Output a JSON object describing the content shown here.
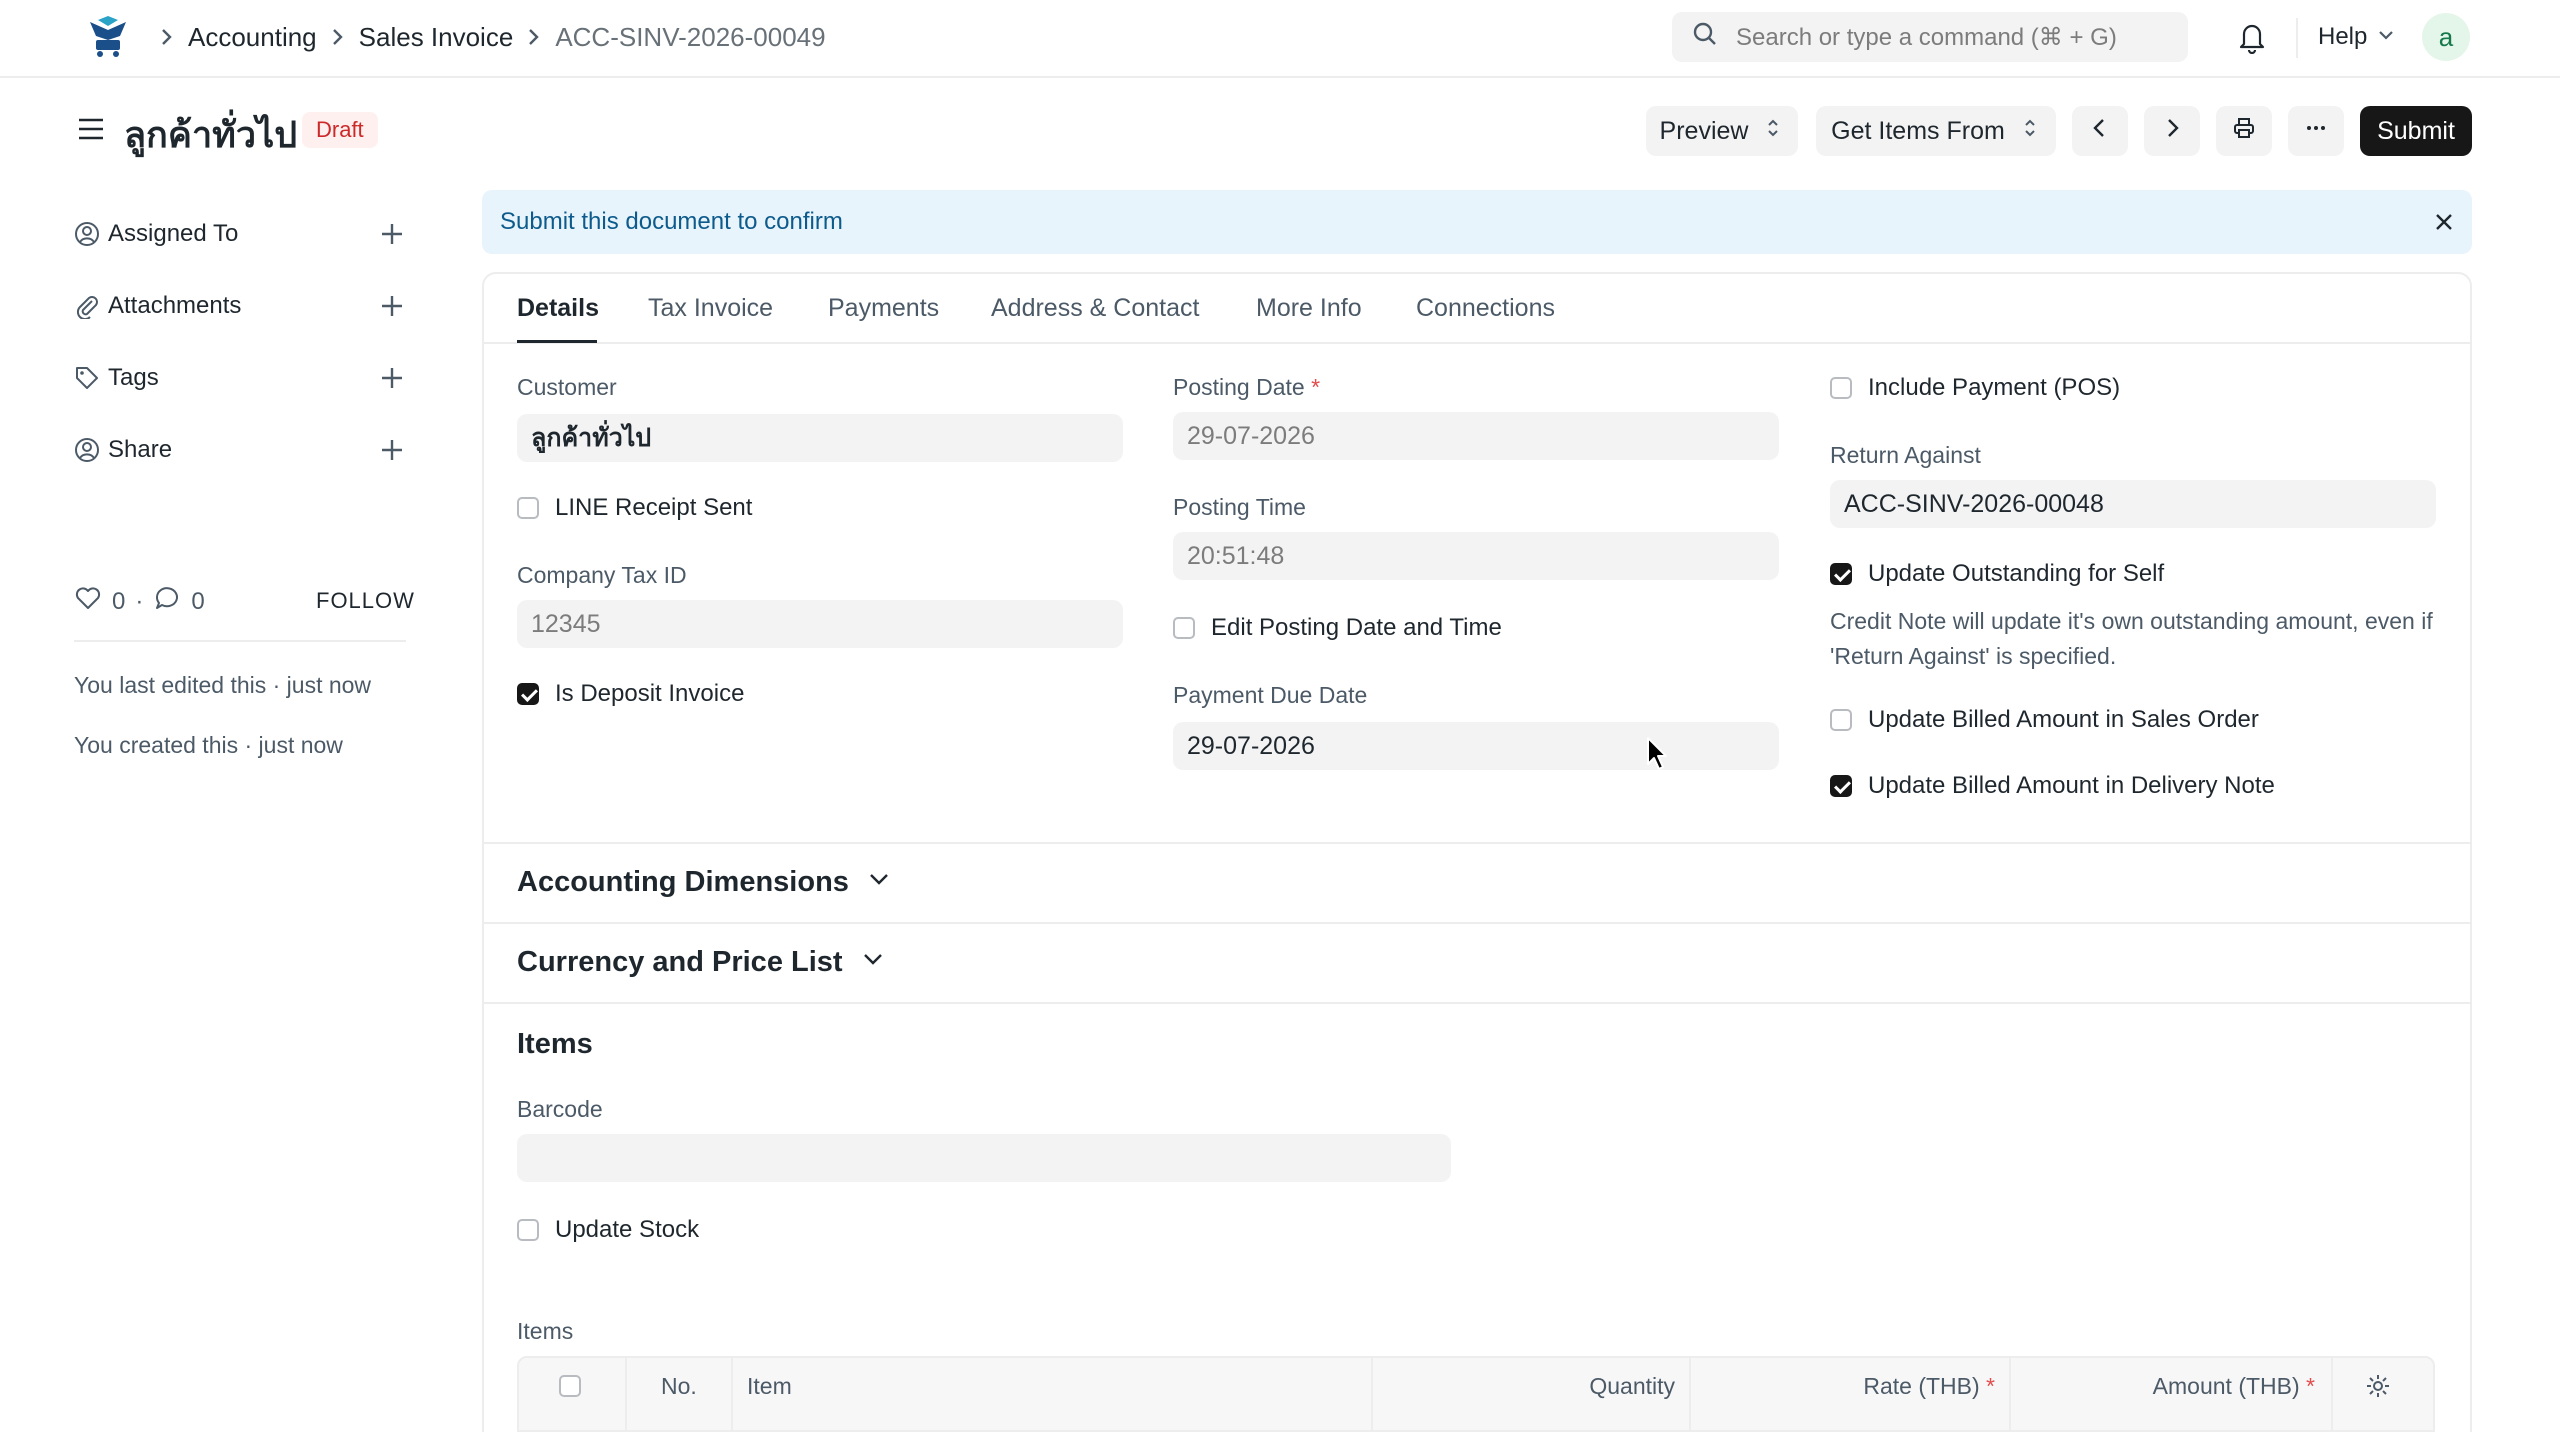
{
  "navbar": {
    "breadcrumbs": [
      "Accounting",
      "Sales Invoice",
      "ACC-SINV-2026-00049"
    ],
    "search_placeholder": "Search or type a command (⌘ + G)",
    "help_label": "Help",
    "avatar_letter": "a"
  },
  "page": {
    "title": "ลูกค้าทั่วไป",
    "status": "Draft",
    "preview_label": "Preview",
    "get_items_label": "Get Items From",
    "submit_label": "Submit"
  },
  "sidebar": {
    "items": [
      {
        "label": "Assigned To",
        "icon": "user-circle-icon"
      },
      {
        "label": "Attachments",
        "icon": "paperclip-icon"
      },
      {
        "label": "Tags",
        "icon": "tag-icon"
      },
      {
        "label": "Share",
        "icon": "share-user-icon"
      }
    ],
    "likes_count": "0",
    "comments_count": "0",
    "follow_label": "FOLLOW",
    "last_edited": "You last edited this · just now",
    "created": "You created this · just now"
  },
  "alert": {
    "message": "Submit this document to confirm"
  },
  "tabs": [
    "Details",
    "Tax Invoice",
    "Payments",
    "Address & Contact",
    "More Info",
    "Connections"
  ],
  "form": {
    "customer_label": "Customer",
    "customer_value": "ลูกค้าทั่วไป",
    "line_receipt_label": "LINE Receipt Sent",
    "line_receipt_checked": false,
    "company_tax_label": "Company Tax ID",
    "company_tax_value": "12345",
    "is_deposit_label": "Is Deposit Invoice",
    "is_deposit_checked": true,
    "posting_date_label": "Posting Date",
    "posting_date_value": "29-07-2026",
    "posting_time_label": "Posting Time",
    "posting_time_value": "20:51:48",
    "edit_posting_label": "Edit Posting Date and Time",
    "edit_posting_checked": false,
    "due_date_label": "Payment Due Date",
    "due_date_value": "29-07-2026",
    "include_payment_label": "Include Payment (POS)",
    "include_payment_checked": false,
    "return_against_label": "Return Against",
    "return_against_value": "ACC-SINV-2026-00048",
    "update_outstanding_label": "Update Outstanding for Self",
    "update_outstanding_checked": true,
    "update_outstanding_desc": "Credit Note will update it's own outstanding amount, even if 'Return Against' is specified.",
    "update_billed_so_label": "Update Billed Amount in Sales Order",
    "update_billed_so_checked": false,
    "update_billed_dn_label": "Update Billed Amount in Delivery Note",
    "update_billed_dn_checked": true
  },
  "sections": {
    "accounting_dimensions": "Accounting Dimensions",
    "currency_price_list": "Currency and Price List",
    "items": "Items"
  },
  "items_section": {
    "barcode_label": "Barcode",
    "update_stock_label": "Update Stock",
    "update_stock_checked": false,
    "table_label": "Items",
    "columns": [
      "No.",
      "Item",
      "Quantity",
      "Rate (THB)",
      "Amount (THB)"
    ]
  }
}
